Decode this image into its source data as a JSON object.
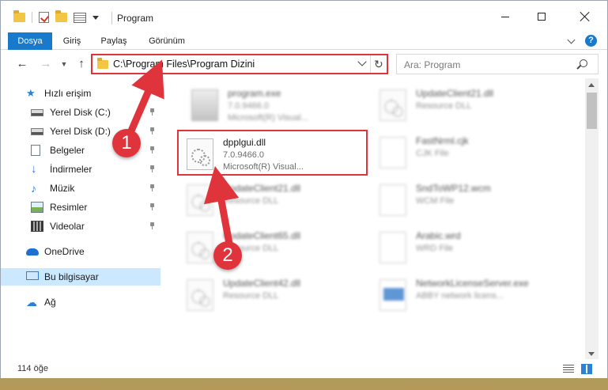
{
  "window": {
    "title": "Program"
  },
  "ribbon": {
    "tabs": [
      "Dosya",
      "Giriş",
      "Paylaş",
      "Görünüm"
    ],
    "help": "?"
  },
  "nav": {
    "address_path": "C:\\Program Files\\Program Dizini",
    "search_placeholder": "Ara: Program"
  },
  "sidebar": {
    "quick_access": "Hızlı erişim",
    "items": [
      {
        "label": "Yerel Disk (C:)",
        "icon": "disk-icon"
      },
      {
        "label": "Yerel Disk (D:)",
        "icon": "disk-icon"
      },
      {
        "label": "Belgeler",
        "icon": "documents-icon"
      },
      {
        "label": "İndirmeler",
        "icon": "downloads-icon"
      },
      {
        "label": "Müzik",
        "icon": "music-icon"
      },
      {
        "label": "Resimler",
        "icon": "pictures-icon"
      },
      {
        "label": "Videolar",
        "icon": "videos-icon"
      }
    ],
    "onedrive": "OneDrive",
    "this_pc": "Bu bilgisayar",
    "network": "Ağ"
  },
  "files": [
    {
      "name": "program.exe",
      "line2": "7.0.9466.0",
      "line3": "Microsoft(R) Visual...",
      "type": "exe",
      "blurred": true
    },
    {
      "name": "dpplgui.dll",
      "line2": "7.0.9466.0",
      "line3": "Microsoft(R) Visual...",
      "type": "dll",
      "blurred": false,
      "highlighted": true
    },
    {
      "name": "UpdateClient21.dll",
      "line2": "Resource DLL",
      "line3": "",
      "type": "dll",
      "blurred": true
    },
    {
      "name": "UpdateClient65.dll",
      "line2": "Resource DLL",
      "line3": "",
      "type": "dll",
      "blurred": true
    },
    {
      "name": "UpdateClient42.dll",
      "line2": "Resource DLL",
      "line3": "",
      "type": "dll",
      "blurred": true
    },
    {
      "name": "UpdateClient21.dll",
      "line2": "Resource DLL",
      "line3": "",
      "type": "dll",
      "blurred": true
    },
    {
      "name": "FastNrml.cjk",
      "line2": "CJK File",
      "line3": "",
      "type": "page",
      "blurred": true
    },
    {
      "name": "SndToWP12.wcm",
      "line2": "WCM File",
      "line3": "",
      "type": "page",
      "blurred": true
    },
    {
      "name": "Arabic.wrd",
      "line2": "WRD File",
      "line3": "",
      "type": "page",
      "blurred": true
    },
    {
      "name": "NetworkLicenseServer.exe",
      "line2": "ABBY network licens...",
      "line3": "",
      "type": "net",
      "blurred": true
    }
  ],
  "status": {
    "item_count": "114 öğe"
  },
  "callouts": [
    "1",
    "2"
  ],
  "colors": {
    "accent": "#1979ca",
    "highlight": "#e0343c",
    "selected": "#cce8ff"
  }
}
